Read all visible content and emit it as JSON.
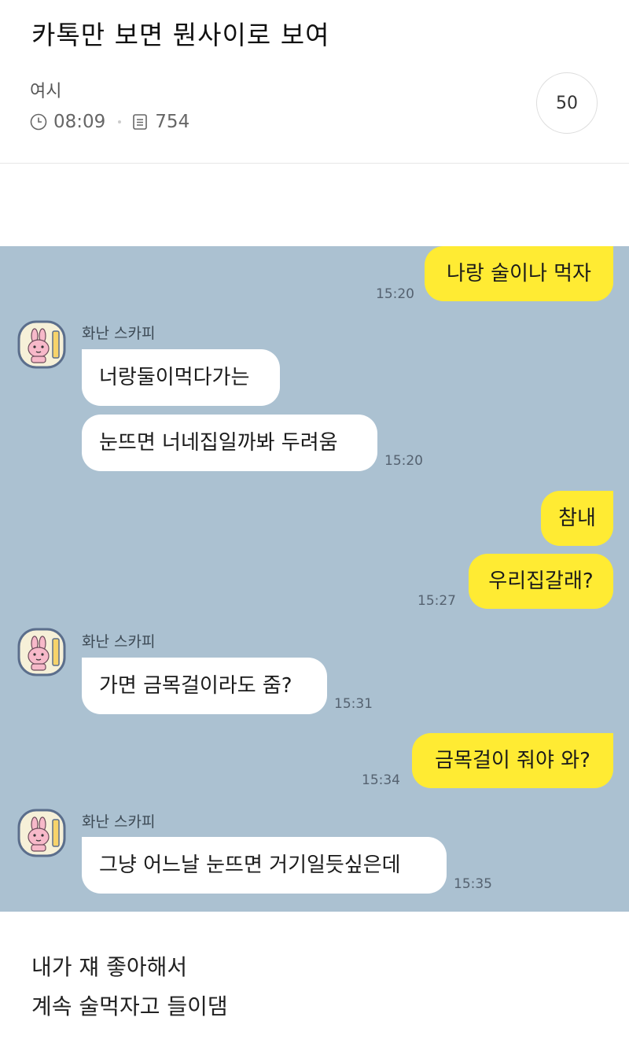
{
  "post": {
    "title": "카톡만 보면 뭔사이로 보여",
    "author": "여시",
    "time": "08:09",
    "views": "754",
    "comments": "50"
  },
  "chat": {
    "sender_name": "화난 스카피",
    "messages": [
      {
        "from": "me",
        "text": "나랑 술이나 먹자",
        "time": "15:20"
      },
      {
        "from": "other",
        "text": "너랑둘이먹다가는"
      },
      {
        "from": "other",
        "text": "눈뜨면 너네집일까봐 두려움",
        "time": "15:20"
      },
      {
        "from": "me",
        "text": "참내"
      },
      {
        "from": "me",
        "text": "우리집갈래?",
        "time": "15:27"
      },
      {
        "from": "other",
        "text": "가면 금목걸이라도 줌?",
        "time": "15:31"
      },
      {
        "from": "me",
        "text": "금목걸이 줘야 와?",
        "time": "15:34"
      },
      {
        "from": "other",
        "text": "그냥 어느날 눈뜨면 거기일듯싶은데",
        "time": "15:35"
      }
    ]
  },
  "caption": {
    "line1": "내가 쟤 좋아해서",
    "line2": "계속 술먹자고 들이댐"
  },
  "colors": {
    "chat_background": "#abc1d1",
    "my_bubble": "#ffeb33",
    "other_bubble": "#ffffff"
  },
  "icons": {
    "time": "clock-icon",
    "views": "document-icon",
    "avatar": "pink-bunny-avatar-icon"
  }
}
